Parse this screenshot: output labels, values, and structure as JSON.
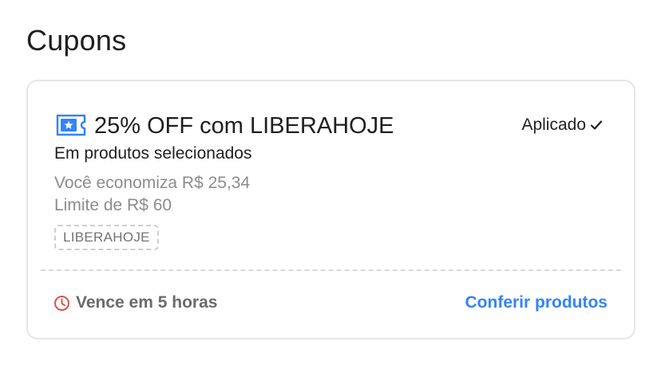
{
  "section": {
    "title": "Cupons"
  },
  "coupon": {
    "title": "25% OFF com LIBERAHOJE",
    "status": "Aplicado",
    "subtitle": "Em produtos selecionados",
    "savings": "Você economiza R$ 25,34",
    "limit": "Limite de R$ 60",
    "code": "LIBERAHOJE",
    "expiry": "Vence em 5 horas",
    "link_label": "Conferir produtos",
    "icons": {
      "coupon": "ticket-star-icon",
      "status": "check-icon",
      "expiry": "clock-icon"
    },
    "colors": {
      "accent": "#3483fa",
      "expiry_icon": "#d9534f",
      "muted_text": "#8c8c8c"
    }
  }
}
